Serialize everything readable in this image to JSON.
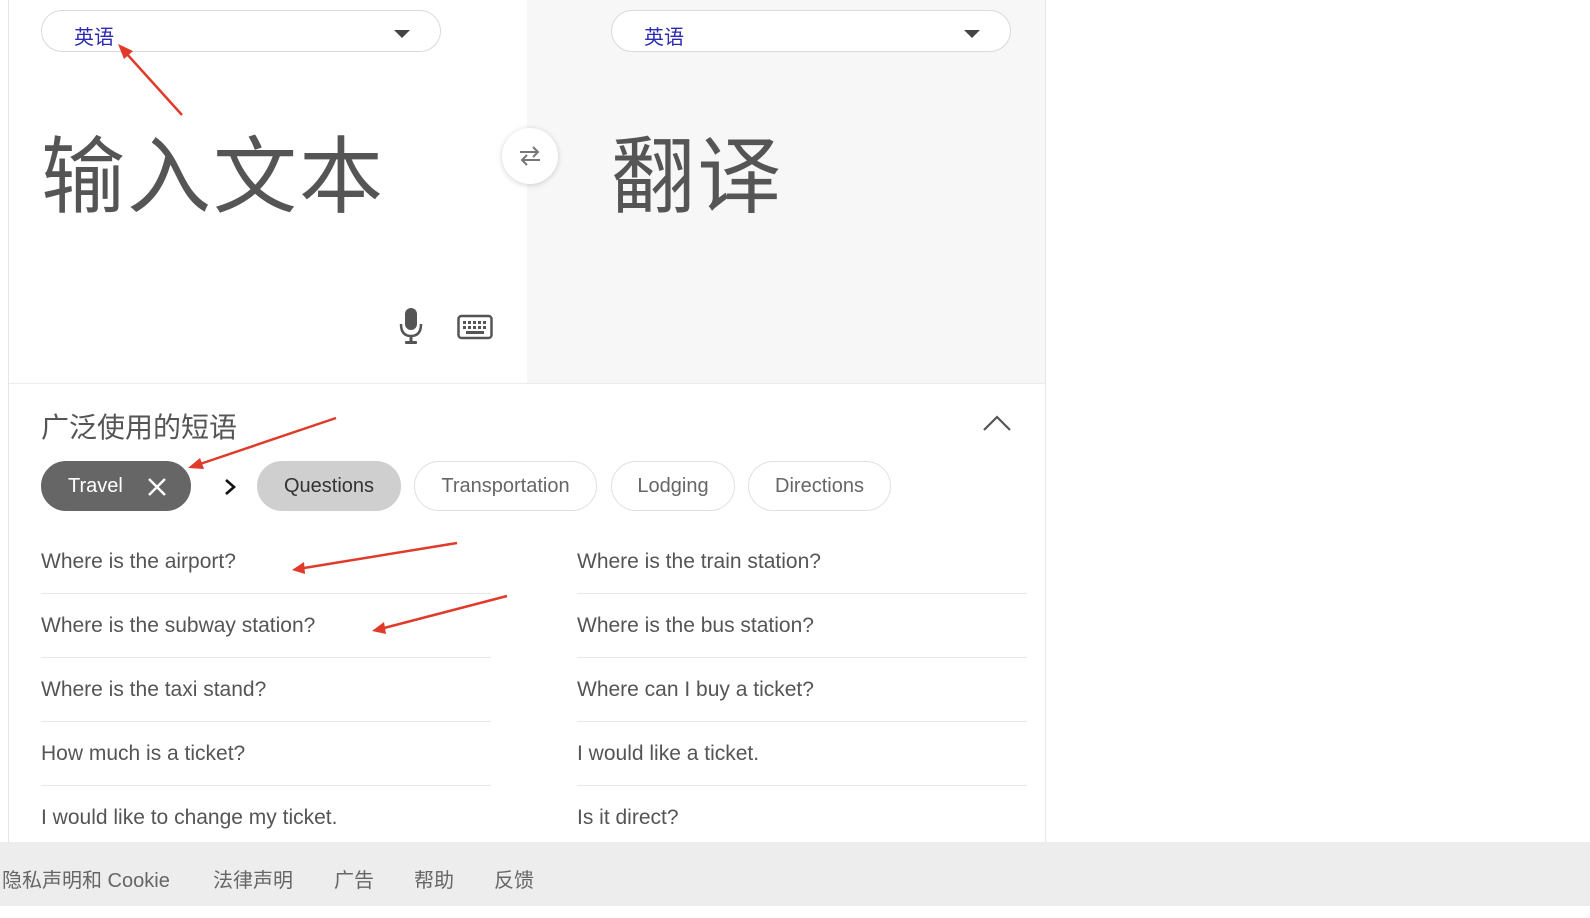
{
  "source_lang": {
    "label": "英语"
  },
  "target_lang": {
    "label": "英语"
  },
  "input_placeholder": "输入文本",
  "output_placeholder": "翻译",
  "icons": {
    "swap": "swap-arrows-icon",
    "mic": "microphone-icon",
    "keyboard": "keyboard-icon",
    "collapse": "chevron-up-icon",
    "chip_close": "close-icon",
    "chip_next": "chevron-right-icon"
  },
  "phrases_section": {
    "title": "广泛使用的短语",
    "category_chip": "Travel",
    "subcategories": [
      {
        "label": "Questions",
        "active": true
      },
      {
        "label": "Transportation",
        "active": false
      },
      {
        "label": "Lodging",
        "active": false
      },
      {
        "label": "Directions",
        "active": false
      }
    ],
    "left_phrases": [
      "Where is the airport?",
      "Where is the subway station?",
      "Where is the taxi stand?",
      "How much is a ticket?",
      "I would like to change my ticket."
    ],
    "right_phrases": [
      "Where is the train station?",
      "Where is the bus station?",
      "Where can I buy a ticket?",
      "I would like a ticket.",
      "Is it direct?"
    ]
  },
  "footer": {
    "links": [
      "隐私声明和 Cookie",
      "法律声明",
      "广告",
      "帮助",
      "反馈"
    ]
  },
  "colors": {
    "lang_label": "#2c2ab0",
    "annotation_arrow": "#e03b2a",
    "active_chip": "#cfcfcf",
    "travel_chip": "#666666",
    "footer_bg": "#ededed"
  }
}
